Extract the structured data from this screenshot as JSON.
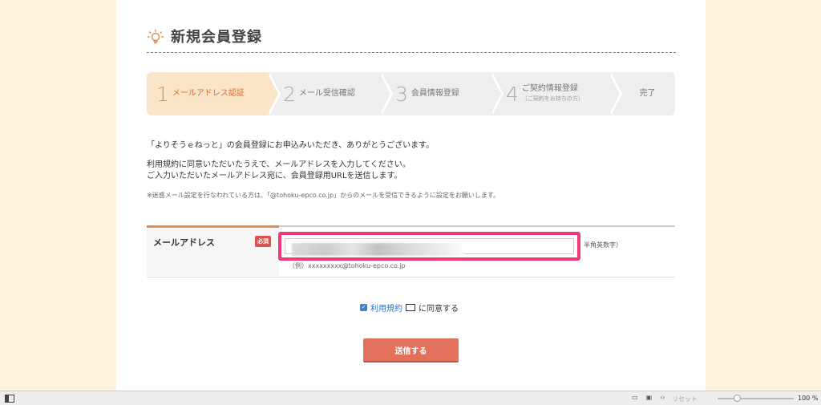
{
  "page": {
    "title": "新規会員登録"
  },
  "steps": [
    {
      "num": "1",
      "label": "メールアドレス認証",
      "sub": ""
    },
    {
      "num": "2",
      "label": "メール受信確認",
      "sub": ""
    },
    {
      "num": "3",
      "label": "会員情報登録",
      "sub": ""
    },
    {
      "num": "4",
      "label": "ご契約情報登録",
      "sub": "（ご契約をお持ちの方）"
    },
    {
      "num": "",
      "label": "完了",
      "sub": ""
    }
  ],
  "messages": {
    "line1": "「よりそうｅねっと」の会員登録にお申込みいただき、ありがとうございます。",
    "line2": "利用規約に同意いただいたうえで、メールアドレスを入力してください。",
    "line3": "ご入力いただいたメールアドレス宛に、会員登録用URLを送信します。",
    "note": "※迷惑メール設定を行なわれている方は、「@tohoku-epco.co.jp」からのメールを受信できるように設定をお願いします。"
  },
  "form": {
    "email_label": "メールアドレス",
    "required_badge": "必須",
    "suffix": "半角英数字）",
    "example": "（例）xxxxxxxxx@tohoku-epco.co.jp"
  },
  "agree": {
    "link_text": "利用規約",
    "text": "に同意する",
    "checked": true
  },
  "submit": {
    "label": "送信する"
  },
  "statusbar": {
    "reset": "リセット",
    "zoom": "100 %"
  },
  "colors": {
    "accent": "#e58a4c",
    "highlight": "#f03a7c",
    "submit": "#e2705b",
    "background": "#fdf3dc"
  }
}
